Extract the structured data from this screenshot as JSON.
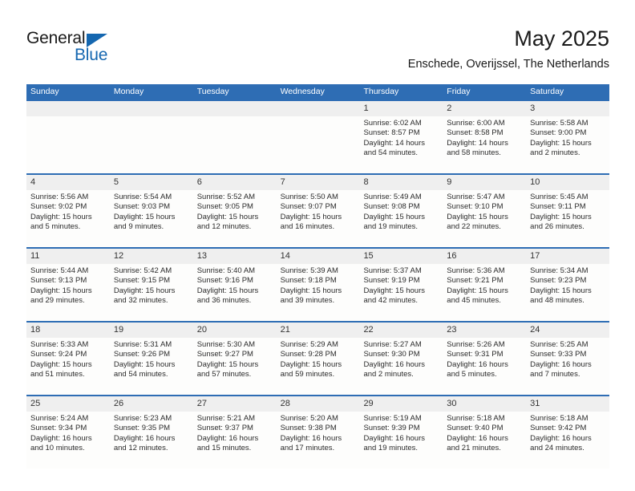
{
  "brand": {
    "name_top": "General",
    "name_bottom": "Blue",
    "accent_color": "#1567b0"
  },
  "header": {
    "title": "May 2025",
    "subtitle": "Enschede, Overijssel, The Netherlands"
  },
  "theme": {
    "header_blue": "#2e6db4",
    "daynum_band": "#efefef",
    "cell_background": "#fdfdfc"
  },
  "weekdays": [
    "Sunday",
    "Monday",
    "Tuesday",
    "Wednesday",
    "Thursday",
    "Friday",
    "Saturday"
  ],
  "weeks": [
    [
      {
        "day": "",
        "sunrise": "",
        "sunset": "",
        "daylight": ""
      },
      {
        "day": "",
        "sunrise": "",
        "sunset": "",
        "daylight": ""
      },
      {
        "day": "",
        "sunrise": "",
        "sunset": "",
        "daylight": ""
      },
      {
        "day": "",
        "sunrise": "",
        "sunset": "",
        "daylight": ""
      },
      {
        "day": "1",
        "sunrise": "Sunrise: 6:02 AM",
        "sunset": "Sunset: 8:57 PM",
        "daylight": "Daylight: 14 hours and 54 minutes."
      },
      {
        "day": "2",
        "sunrise": "Sunrise: 6:00 AM",
        "sunset": "Sunset: 8:58 PM",
        "daylight": "Daylight: 14 hours and 58 minutes."
      },
      {
        "day": "3",
        "sunrise": "Sunrise: 5:58 AM",
        "sunset": "Sunset: 9:00 PM",
        "daylight": "Daylight: 15 hours and 2 minutes."
      }
    ],
    [
      {
        "day": "4",
        "sunrise": "Sunrise: 5:56 AM",
        "sunset": "Sunset: 9:02 PM",
        "daylight": "Daylight: 15 hours and 5 minutes."
      },
      {
        "day": "5",
        "sunrise": "Sunrise: 5:54 AM",
        "sunset": "Sunset: 9:03 PM",
        "daylight": "Daylight: 15 hours and 9 minutes."
      },
      {
        "day": "6",
        "sunrise": "Sunrise: 5:52 AM",
        "sunset": "Sunset: 9:05 PM",
        "daylight": "Daylight: 15 hours and 12 minutes."
      },
      {
        "day": "7",
        "sunrise": "Sunrise: 5:50 AM",
        "sunset": "Sunset: 9:07 PM",
        "daylight": "Daylight: 15 hours and 16 minutes."
      },
      {
        "day": "8",
        "sunrise": "Sunrise: 5:49 AM",
        "sunset": "Sunset: 9:08 PM",
        "daylight": "Daylight: 15 hours and 19 minutes."
      },
      {
        "day": "9",
        "sunrise": "Sunrise: 5:47 AM",
        "sunset": "Sunset: 9:10 PM",
        "daylight": "Daylight: 15 hours and 22 minutes."
      },
      {
        "day": "10",
        "sunrise": "Sunrise: 5:45 AM",
        "sunset": "Sunset: 9:11 PM",
        "daylight": "Daylight: 15 hours and 26 minutes."
      }
    ],
    [
      {
        "day": "11",
        "sunrise": "Sunrise: 5:44 AM",
        "sunset": "Sunset: 9:13 PM",
        "daylight": "Daylight: 15 hours and 29 minutes."
      },
      {
        "day": "12",
        "sunrise": "Sunrise: 5:42 AM",
        "sunset": "Sunset: 9:15 PM",
        "daylight": "Daylight: 15 hours and 32 minutes."
      },
      {
        "day": "13",
        "sunrise": "Sunrise: 5:40 AM",
        "sunset": "Sunset: 9:16 PM",
        "daylight": "Daylight: 15 hours and 36 minutes."
      },
      {
        "day": "14",
        "sunrise": "Sunrise: 5:39 AM",
        "sunset": "Sunset: 9:18 PM",
        "daylight": "Daylight: 15 hours and 39 minutes."
      },
      {
        "day": "15",
        "sunrise": "Sunrise: 5:37 AM",
        "sunset": "Sunset: 9:19 PM",
        "daylight": "Daylight: 15 hours and 42 minutes."
      },
      {
        "day": "16",
        "sunrise": "Sunrise: 5:36 AM",
        "sunset": "Sunset: 9:21 PM",
        "daylight": "Daylight: 15 hours and 45 minutes."
      },
      {
        "day": "17",
        "sunrise": "Sunrise: 5:34 AM",
        "sunset": "Sunset: 9:23 PM",
        "daylight": "Daylight: 15 hours and 48 minutes."
      }
    ],
    [
      {
        "day": "18",
        "sunrise": "Sunrise: 5:33 AM",
        "sunset": "Sunset: 9:24 PM",
        "daylight": "Daylight: 15 hours and 51 minutes."
      },
      {
        "day": "19",
        "sunrise": "Sunrise: 5:31 AM",
        "sunset": "Sunset: 9:26 PM",
        "daylight": "Daylight: 15 hours and 54 minutes."
      },
      {
        "day": "20",
        "sunrise": "Sunrise: 5:30 AM",
        "sunset": "Sunset: 9:27 PM",
        "daylight": "Daylight: 15 hours and 57 minutes."
      },
      {
        "day": "21",
        "sunrise": "Sunrise: 5:29 AM",
        "sunset": "Sunset: 9:28 PM",
        "daylight": "Daylight: 15 hours and 59 minutes."
      },
      {
        "day": "22",
        "sunrise": "Sunrise: 5:27 AM",
        "sunset": "Sunset: 9:30 PM",
        "daylight": "Daylight: 16 hours and 2 minutes."
      },
      {
        "day": "23",
        "sunrise": "Sunrise: 5:26 AM",
        "sunset": "Sunset: 9:31 PM",
        "daylight": "Daylight: 16 hours and 5 minutes."
      },
      {
        "day": "24",
        "sunrise": "Sunrise: 5:25 AM",
        "sunset": "Sunset: 9:33 PM",
        "daylight": "Daylight: 16 hours and 7 minutes."
      }
    ],
    [
      {
        "day": "25",
        "sunrise": "Sunrise: 5:24 AM",
        "sunset": "Sunset: 9:34 PM",
        "daylight": "Daylight: 16 hours and 10 minutes."
      },
      {
        "day": "26",
        "sunrise": "Sunrise: 5:23 AM",
        "sunset": "Sunset: 9:35 PM",
        "daylight": "Daylight: 16 hours and 12 minutes."
      },
      {
        "day": "27",
        "sunrise": "Sunrise: 5:21 AM",
        "sunset": "Sunset: 9:37 PM",
        "daylight": "Daylight: 16 hours and 15 minutes."
      },
      {
        "day": "28",
        "sunrise": "Sunrise: 5:20 AM",
        "sunset": "Sunset: 9:38 PM",
        "daylight": "Daylight: 16 hours and 17 minutes."
      },
      {
        "day": "29",
        "sunrise": "Sunrise: 5:19 AM",
        "sunset": "Sunset: 9:39 PM",
        "daylight": "Daylight: 16 hours and 19 minutes."
      },
      {
        "day": "30",
        "sunrise": "Sunrise: 5:18 AM",
        "sunset": "Sunset: 9:40 PM",
        "daylight": "Daylight: 16 hours and 21 minutes."
      },
      {
        "day": "31",
        "sunrise": "Sunrise: 5:18 AM",
        "sunset": "Sunset: 9:42 PM",
        "daylight": "Daylight: 16 hours and 24 minutes."
      }
    ]
  ]
}
